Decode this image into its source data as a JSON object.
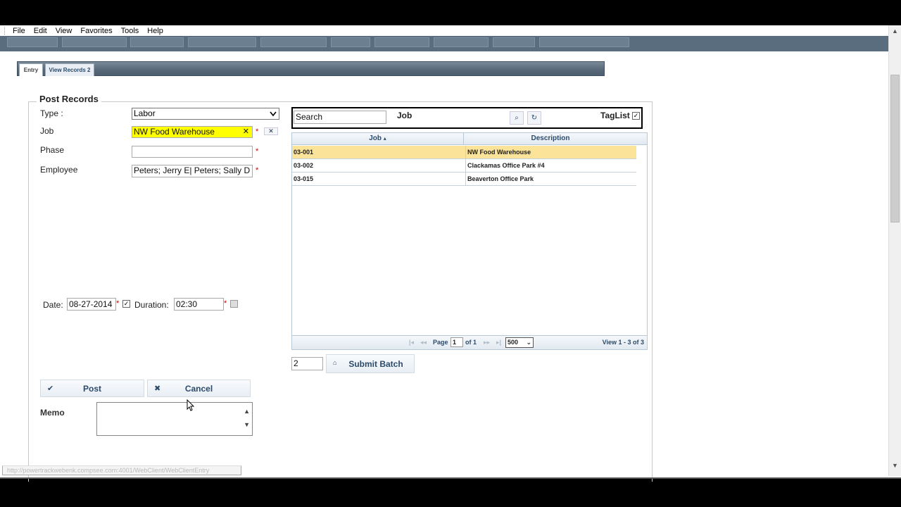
{
  "menu": [
    "File",
    "Edit",
    "View",
    "Favorites",
    "Tools",
    "Help"
  ],
  "tabs": {
    "entry": "Entry",
    "view_records": "View Records 2"
  },
  "form": {
    "legend": "Post Records",
    "type_label": "Type :",
    "type_value": "Labor",
    "job_label": "Job",
    "job_value": "NW Food Warehouse",
    "phase_label": "Phase",
    "phase_value": "",
    "employee_label": "Employee",
    "employee_value": "Peters; Jerry E| Peters; Sally D",
    "required_mark": "*",
    "date_label": "Date:",
    "date_value": "08-27-2014",
    "duration_label": "Duration:",
    "duration_value": "02:30",
    "memo_label": "Memo",
    "post_label": "Post",
    "cancel_label": "Cancel"
  },
  "lookup": {
    "search_value": "Search",
    "field_label": "Job",
    "taglist_label": "TagList",
    "columns": [
      "Job",
      "Description"
    ],
    "rows": [
      {
        "job": "03-001",
        "description": "NW Food Warehouse"
      },
      {
        "job": "03-002",
        "description": "Clackamas Office Park #4"
      },
      {
        "job": "03-015",
        "description": "Beaverton Office Park"
      }
    ],
    "pager": {
      "page_label": "Page",
      "page_value": "1",
      "of_label": "of 1",
      "page_size": "500",
      "view_text": "View 1 - 3 of 3"
    }
  },
  "batch": {
    "count_value": "2",
    "submit_label": "Submit Batch"
  },
  "status_url": "http://powertrackwebenk.compsee.com:4001/WebClient/WebClientEntry",
  "colors": {
    "nav": "#5a6d7e",
    "selected_row": "#fbe39a",
    "highlight": "#ffff00",
    "accent_text": "#2c4a6a"
  }
}
